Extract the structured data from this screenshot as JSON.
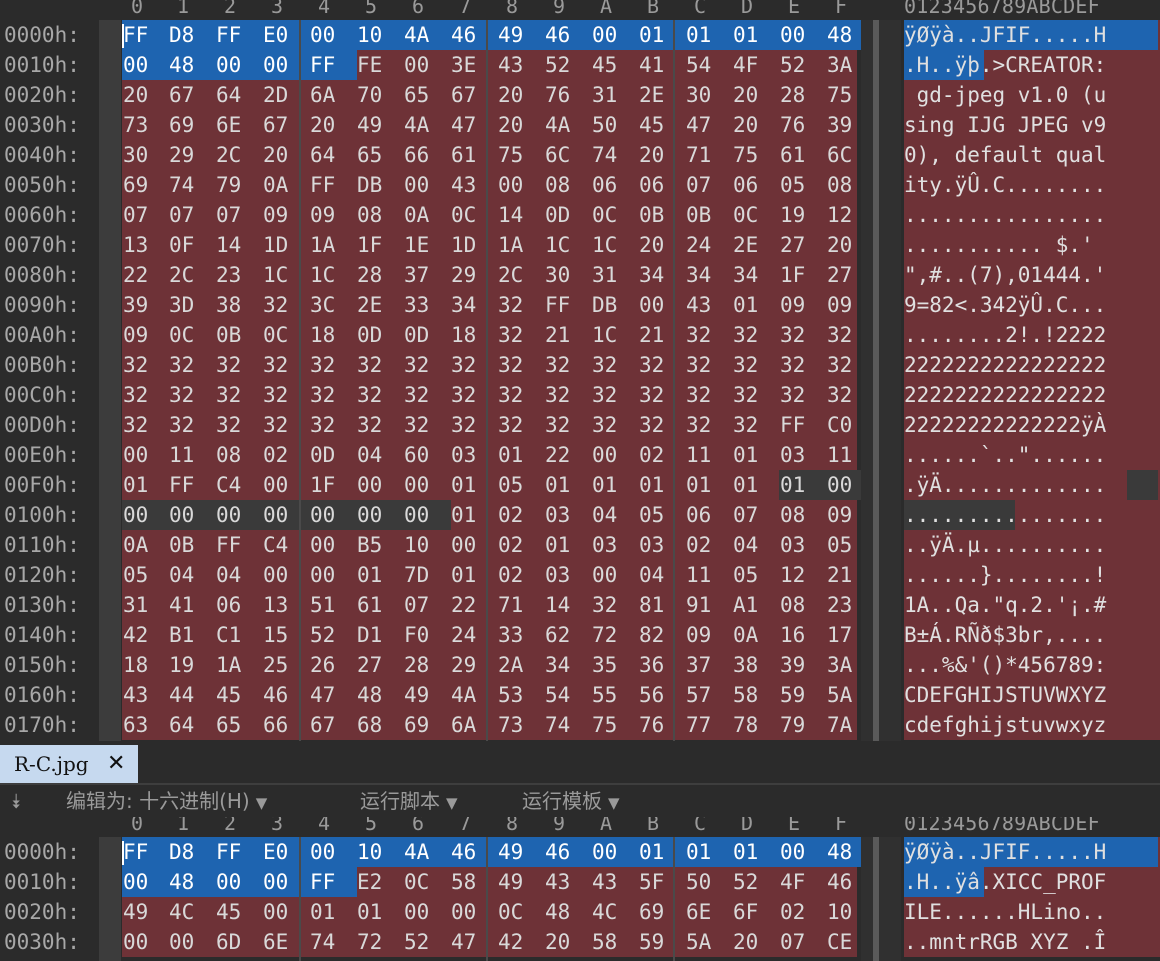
{
  "columns": [
    "0",
    "1",
    "2",
    "3",
    "4",
    "5",
    "6",
    "7",
    "8",
    "9",
    "A",
    "B",
    "C",
    "D",
    "E",
    "F"
  ],
  "ascii_header": "0123456789ABCDEF",
  "top": {
    "rows": [
      {
        "off": "0000h:",
        "hex": [
          "FF",
          "D8",
          "FF",
          "E0",
          "00",
          "10",
          "4A",
          "46",
          "49",
          "46",
          "00",
          "01",
          "01",
          "01",
          "00",
          "48"
        ],
        "ascii": "ÿØÿà..JFIF.....H",
        "sel": [
          0,
          16
        ],
        "gap": null,
        "asel": [
          0,
          16
        ],
        "agap": null
      },
      {
        "off": "0010h:",
        "hex": [
          "00",
          "48",
          "00",
          "00",
          "FF",
          "FE",
          "00",
          "3E",
          "43",
          "52",
          "45",
          "41",
          "54",
          "4F",
          "52",
          "3A"
        ],
        "ascii": ".H..ÿþ.>CREATOR:",
        "sel": [
          0,
          5
        ],
        "gap": null,
        "asel": [
          0,
          5
        ],
        "agap": null
      },
      {
        "off": "0020h:",
        "hex": [
          "20",
          "67",
          "64",
          "2D",
          "6A",
          "70",
          "65",
          "67",
          "20",
          "76",
          "31",
          "2E",
          "30",
          "20",
          "28",
          "75"
        ],
        "ascii": " gd-jpeg v1.0 (u"
      },
      {
        "off": "0030h:",
        "hex": [
          "73",
          "69",
          "6E",
          "67",
          "20",
          "49",
          "4A",
          "47",
          "20",
          "4A",
          "50",
          "45",
          "47",
          "20",
          "76",
          "39"
        ],
        "ascii": "sing IJG JPEG v9"
      },
      {
        "off": "0040h:",
        "hex": [
          "30",
          "29",
          "2C",
          "20",
          "64",
          "65",
          "66",
          "61",
          "75",
          "6C",
          "74",
          "20",
          "71",
          "75",
          "61",
          "6C"
        ],
        "ascii": "0), default qual"
      },
      {
        "off": "0050h:",
        "hex": [
          "69",
          "74",
          "79",
          "0A",
          "FF",
          "DB",
          "00",
          "43",
          "00",
          "08",
          "06",
          "06",
          "07",
          "06",
          "05",
          "08"
        ],
        "ascii": "ity.ÿÛ.C........"
      },
      {
        "off": "0060h:",
        "hex": [
          "07",
          "07",
          "07",
          "09",
          "09",
          "08",
          "0A",
          "0C",
          "14",
          "0D",
          "0C",
          "0B",
          "0B",
          "0C",
          "19",
          "12"
        ],
        "ascii": "................"
      },
      {
        "off": "0070h:",
        "hex": [
          "13",
          "0F",
          "14",
          "1D",
          "1A",
          "1F",
          "1E",
          "1D",
          "1A",
          "1C",
          "1C",
          "20",
          "24",
          "2E",
          "27",
          "20"
        ],
        "ascii": "........... $.' "
      },
      {
        "off": "0080h:",
        "hex": [
          "22",
          "2C",
          "23",
          "1C",
          "1C",
          "28",
          "37",
          "29",
          "2C",
          "30",
          "31",
          "34",
          "34",
          "34",
          "1F",
          "27"
        ],
        "ascii": "\",#..(7),01444.'"
      },
      {
        "off": "0090h:",
        "hex": [
          "39",
          "3D",
          "38",
          "32",
          "3C",
          "2E",
          "33",
          "34",
          "32",
          "FF",
          "DB",
          "00",
          "43",
          "01",
          "09",
          "09"
        ],
        "ascii": "9=82<.342ÿÛ.C..."
      },
      {
        "off": "00A0h:",
        "hex": [
          "09",
          "0C",
          "0B",
          "0C",
          "18",
          "0D",
          "0D",
          "18",
          "32",
          "21",
          "1C",
          "21",
          "32",
          "32",
          "32",
          "32"
        ],
        "ascii": "........2!.!2222"
      },
      {
        "off": "00B0h:",
        "hex": [
          "32",
          "32",
          "32",
          "32",
          "32",
          "32",
          "32",
          "32",
          "32",
          "32",
          "32",
          "32",
          "32",
          "32",
          "32",
          "32"
        ],
        "ascii": "2222222222222222"
      },
      {
        "off": "00C0h:",
        "hex": [
          "32",
          "32",
          "32",
          "32",
          "32",
          "32",
          "32",
          "32",
          "32",
          "32",
          "32",
          "32",
          "32",
          "32",
          "32",
          "32"
        ],
        "ascii": "2222222222222222"
      },
      {
        "off": "00D0h:",
        "hex": [
          "32",
          "32",
          "32",
          "32",
          "32",
          "32",
          "32",
          "32",
          "32",
          "32",
          "32",
          "32",
          "32",
          "32",
          "FF",
          "C0"
        ],
        "ascii": "22222222222222ÿÀ"
      },
      {
        "off": "00E0h:",
        "hex": [
          "00",
          "11",
          "08",
          "02",
          "0D",
          "04",
          "60",
          "03",
          "01",
          "22",
          "00",
          "02",
          "11",
          "01",
          "03",
          "11"
        ],
        "ascii": "......`..\"......"
      },
      {
        "off": "00F0h:",
        "hex": [
          "01",
          "FF",
          "C4",
          "00",
          "1F",
          "00",
          "00",
          "01",
          "05",
          "01",
          "01",
          "01",
          "01",
          "01",
          "01",
          "00"
        ],
        "ascii": ".ÿÄ.............",
        "gap": [
          14,
          16
        ],
        "agap": [
          14,
          16
        ]
      },
      {
        "off": "0100h:",
        "hex": [
          "00",
          "00",
          "00",
          "00",
          "00",
          "00",
          "00",
          "01",
          "02",
          "03",
          "04",
          "05",
          "06",
          "07",
          "08",
          "09"
        ],
        "ascii": "................",
        "gap": [
          0,
          7
        ],
        "agap": [
          0,
          7
        ]
      },
      {
        "off": "0110h:",
        "hex": [
          "0A",
          "0B",
          "FF",
          "C4",
          "00",
          "B5",
          "10",
          "00",
          "02",
          "01",
          "03",
          "03",
          "02",
          "04",
          "03",
          "05"
        ],
        "ascii": "..ÿÄ.µ.........."
      },
      {
        "off": "0120h:",
        "hex": [
          "05",
          "04",
          "04",
          "00",
          "00",
          "01",
          "7D",
          "01",
          "02",
          "03",
          "00",
          "04",
          "11",
          "05",
          "12",
          "21"
        ],
        "ascii": "......}........!"
      },
      {
        "off": "0130h:",
        "hex": [
          "31",
          "41",
          "06",
          "13",
          "51",
          "61",
          "07",
          "22",
          "71",
          "14",
          "32",
          "81",
          "91",
          "A1",
          "08",
          "23"
        ],
        "ascii": "1A..Qa.\"q.2.'¡.#"
      },
      {
        "off": "0140h:",
        "hex": [
          "42",
          "B1",
          "C1",
          "15",
          "52",
          "D1",
          "F0",
          "24",
          "33",
          "62",
          "72",
          "82",
          "09",
          "0A",
          "16",
          "17"
        ],
        "ascii": "B±Á.RÑð$3br,...."
      },
      {
        "off": "0150h:",
        "hex": [
          "18",
          "19",
          "1A",
          "25",
          "26",
          "27",
          "28",
          "29",
          "2A",
          "34",
          "35",
          "36",
          "37",
          "38",
          "39",
          "3A"
        ],
        "ascii": "...%&'()*456789:"
      },
      {
        "off": "0160h:",
        "hex": [
          "43",
          "44",
          "45",
          "46",
          "47",
          "48",
          "49",
          "4A",
          "53",
          "54",
          "55",
          "56",
          "57",
          "58",
          "59",
          "5A"
        ],
        "ascii": "CDEFGHIJSTUVWXYZ"
      },
      {
        "off": "0170h:",
        "hex": [
          "63",
          "64",
          "65",
          "66",
          "67",
          "68",
          "69",
          "6A",
          "73",
          "74",
          "75",
          "76",
          "77",
          "78",
          "79",
          "7A"
        ],
        "ascii": "cdefghijstuvwxyz"
      }
    ]
  },
  "tab": {
    "label": "R-C.jpg",
    "close": "✕"
  },
  "toolbar": {
    "collapse_icon": "⯯",
    "edit_as": "编辑为: 十六进制(H)",
    "run_script": "运行脚本",
    "run_template": "运行模板"
  },
  "bottom": {
    "rows": [
      {
        "off": "0000h:",
        "hex": [
          "FF",
          "D8",
          "FF",
          "E0",
          "00",
          "10",
          "4A",
          "46",
          "49",
          "46",
          "00",
          "01",
          "01",
          "01",
          "00",
          "48"
        ],
        "ascii": "ÿØÿà..JFIF.....H",
        "sel": [
          0,
          16
        ],
        "asel": [
          0,
          16
        ]
      },
      {
        "off": "0010h:",
        "hex": [
          "00",
          "48",
          "00",
          "00",
          "FF",
          "E2",
          "0C",
          "58",
          "49",
          "43",
          "43",
          "5F",
          "50",
          "52",
          "4F",
          "46"
        ],
        "ascii": ".H..ÿâ.XICC_PROF",
        "sel": [
          0,
          5
        ],
        "asel": [
          0,
          5
        ]
      },
      {
        "off": "0020h:",
        "hex": [
          "49",
          "4C",
          "45",
          "00",
          "01",
          "01",
          "00",
          "00",
          "0C",
          "48",
          "4C",
          "69",
          "6E",
          "6F",
          "02",
          "10"
        ],
        "ascii": "ILE......HLino.."
      },
      {
        "off": "0030h:",
        "hex": [
          "00",
          "00",
          "6D",
          "6E",
          "74",
          "72",
          "52",
          "47",
          "42",
          "20",
          "58",
          "59",
          "5A",
          "20",
          "07",
          "CE"
        ],
        "ascii": "..mntrRGB XYZ .Î"
      }
    ]
  }
}
